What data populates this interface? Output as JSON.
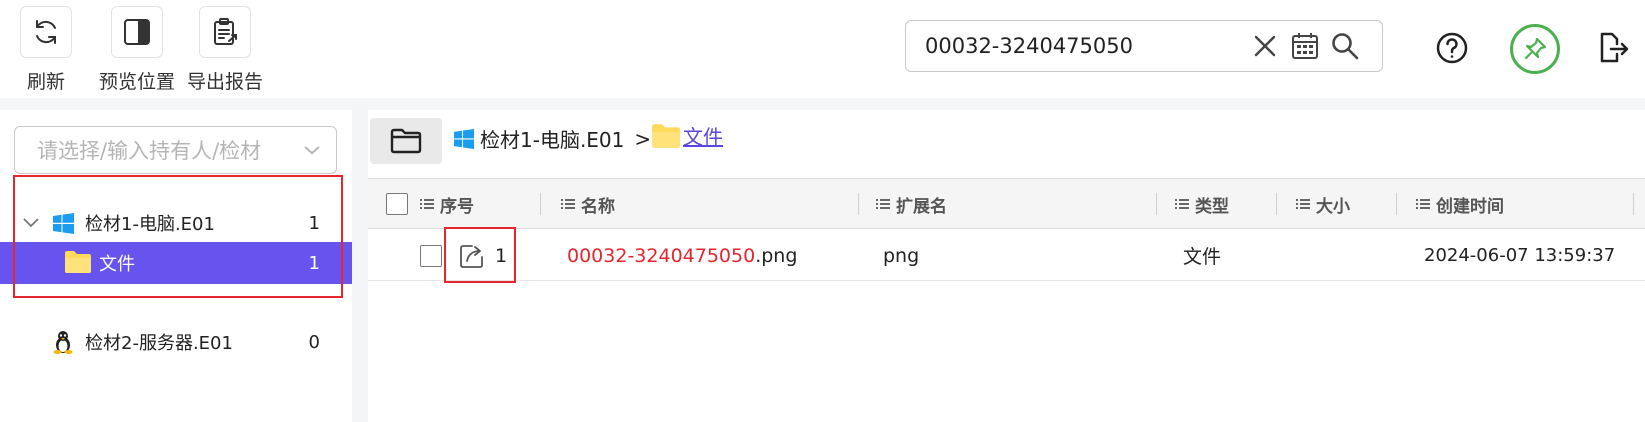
{
  "toolbar": {
    "refresh_label": "刷新",
    "preview_label": "预览位置",
    "export_label": "导出报告"
  },
  "search": {
    "value": "00032-3240475050"
  },
  "sidebar": {
    "owner_placeholder": "请选择/输入持有人/检材",
    "tree": [
      {
        "label": "检材1-电脑.E01",
        "count": "1",
        "icon": "windows-icon",
        "expanded": true
      },
      {
        "label": "文件",
        "count": "1",
        "icon": "folder-icon",
        "selected": true
      },
      {
        "label": "检材2-服务器.E01",
        "count": "0",
        "icon": "linux-icon"
      }
    ]
  },
  "breadcrumb": {
    "root": "检材1-电脑.E01",
    "separator": ">",
    "current": "文件"
  },
  "table": {
    "columns": [
      "序号",
      "名称",
      "扩展名",
      "类型",
      "大小",
      "创建时间"
    ],
    "rows": [
      {
        "index": "1",
        "name_highlight": "00032-3240475050",
        "name_rest": ".png",
        "ext": "png",
        "type": "文件",
        "size": "",
        "created": "2024-06-07 13:59:37"
      }
    ]
  },
  "colors": {
    "accent": "#6753ee",
    "highlight": "#e5262d",
    "status_ring": "#4caf50"
  }
}
